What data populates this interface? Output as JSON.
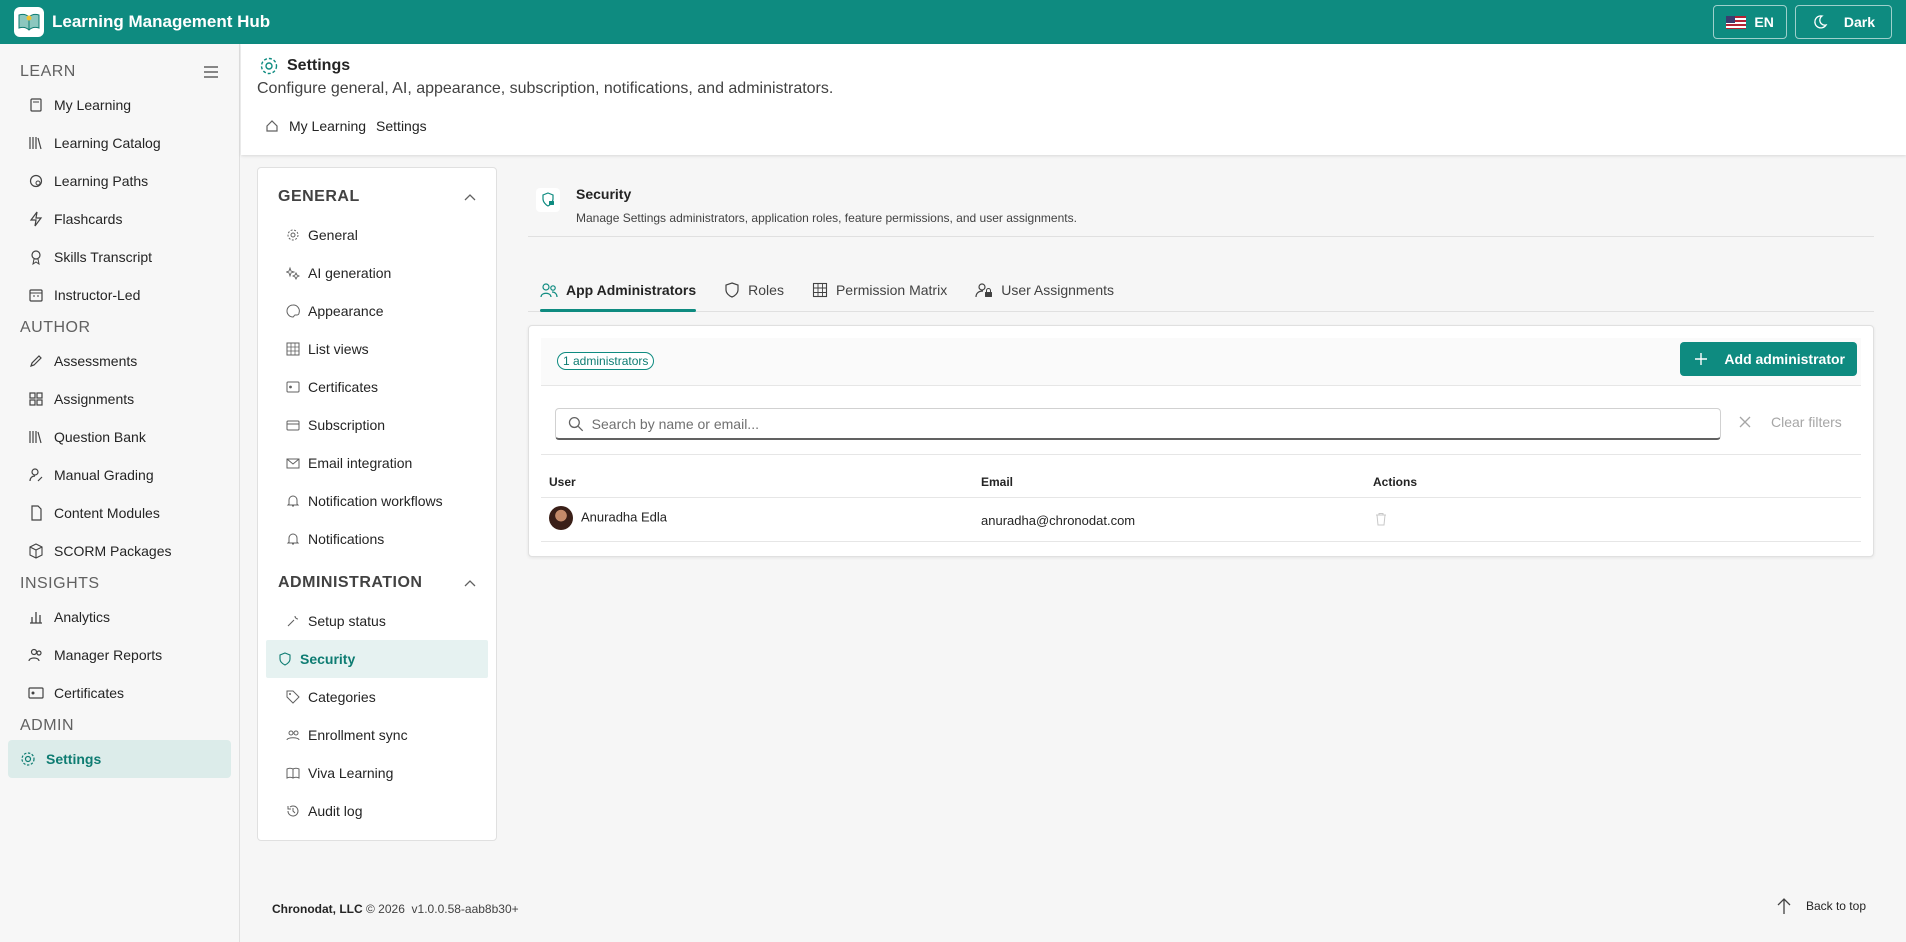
{
  "app": {
    "title": "Learning Management Hub",
    "lang": "EN",
    "theme": "Dark"
  },
  "sidebar": {
    "sections": [
      {
        "label": "LEARN",
        "items": [
          "My Learning",
          "Learning Catalog",
          "Learning Paths",
          "Flashcards",
          "Skills Transcript",
          "Instructor-Led"
        ]
      },
      {
        "label": "AUTHOR",
        "items": [
          "Assessments",
          "Assignments",
          "Question Bank",
          "Manual Grading",
          "Content Modules",
          "SCORM Packages"
        ]
      },
      {
        "label": "INSIGHTS",
        "items": [
          "Analytics",
          "Manager Reports",
          "Certificates"
        ]
      },
      {
        "label": "ADMIN",
        "items": [
          "Settings"
        ]
      }
    ]
  },
  "header": {
    "title": "Settings",
    "subtitle": "Configure general, AI, appearance, subscription, notifications, and administrators.",
    "breadcrumb": [
      "My Learning",
      "Settings"
    ]
  },
  "settings_nav": {
    "general": {
      "label": "GENERAL",
      "items": [
        "General",
        "AI generation",
        "Appearance",
        "List views",
        "Certificates",
        "Subscription",
        "Email integration",
        "Notification workflows",
        "Notifications"
      ]
    },
    "admin": {
      "label": "ADMINISTRATION",
      "items": [
        "Setup status",
        "Security",
        "Categories",
        "Enrollment sync",
        "Viva Learning",
        "Audit log"
      ]
    }
  },
  "section": {
    "title": "Security",
    "description": "Manage Settings administrators, application roles, feature permissions, and user assignments."
  },
  "tabs": [
    "App Administrators",
    "Roles",
    "Permission Matrix",
    "User Assignments"
  ],
  "admins": {
    "count_label": "1 administrators",
    "add_label": "Add administrator",
    "search_placeholder": "Search by name or email...",
    "clear_label": "Clear filters",
    "columns": [
      "User",
      "Email",
      "Actions"
    ],
    "rows": [
      {
        "user": "Anuradha Edla",
        "email": "anuradha@chronodat.com"
      }
    ]
  },
  "footer": {
    "company": "Chronodat, LLC",
    "copyright": "© 2026",
    "version": "v1.0.0.58-aab8b30+",
    "back_to_top": "Back to top"
  },
  "colors": {
    "accent": "#0e8b80",
    "accent_dark": "#0e7c72"
  }
}
